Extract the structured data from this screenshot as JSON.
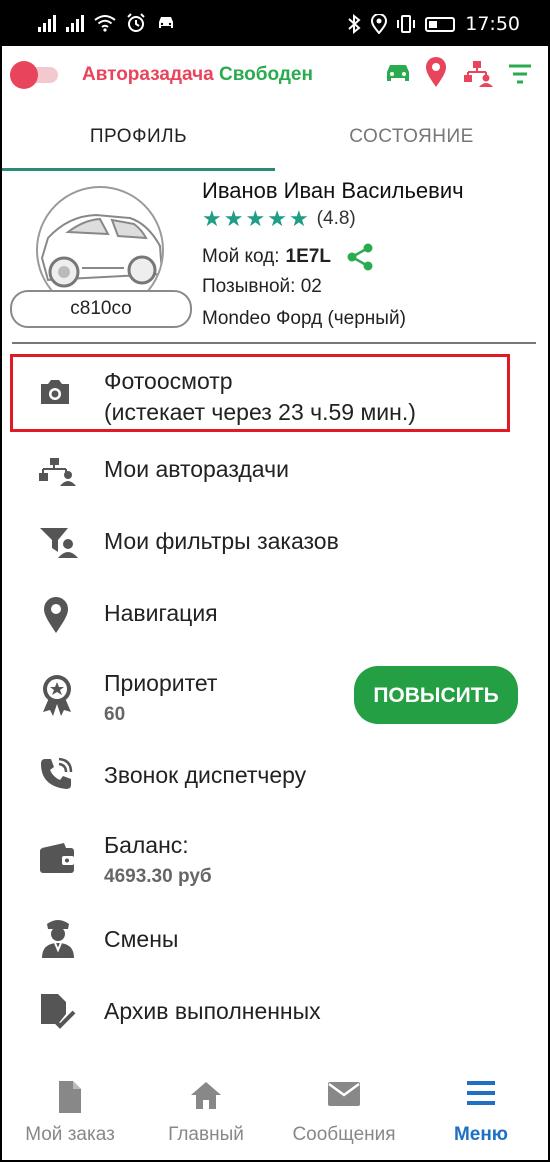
{
  "status_bar": {
    "time": "17:50"
  },
  "app_bar": {
    "title_prefix": "Авторазадача",
    "title_status": "Свободен",
    "colors": {
      "accent_red": "#e8445c",
      "accent_green": "#2bab4f"
    },
    "icons": [
      "car-icon",
      "location-pin-icon",
      "hierarchy-users-icon",
      "filter-icon"
    ]
  },
  "tabs": [
    {
      "label": "ПРОФИЛЬ",
      "active": true
    },
    {
      "label": "СОСТОЯНИЕ",
      "active": false
    }
  ],
  "profile": {
    "name": "Иванов Иван Васильевич",
    "rating_value": 4.8,
    "rating_text": "(4.8)",
    "code_label": "Мой код:",
    "code_value": "1E7L",
    "callsign": "Позывной: 02",
    "car": "Mondeo Форд (черный)",
    "plate": "с810со"
  },
  "menu": {
    "photo_inspection": {
      "label": "Фотоосмотр",
      "sub": "(истекает через 23 ч.59 мин.)"
    },
    "my_auto_dispatch": {
      "label": "Мои автораздачи"
    },
    "my_order_filters": {
      "label": "Мои фильтры заказов"
    },
    "navigation": {
      "label": "Навигация"
    },
    "priority": {
      "label": "Приоритет",
      "value": "60",
      "button": "ПОВЫСИТЬ"
    },
    "call_dispatcher": {
      "label": "Звонок диспетчеру"
    },
    "balance": {
      "label": "Баланс:",
      "value": "4693.30 руб"
    },
    "shifts": {
      "label": "Смены"
    },
    "archive": {
      "label": "Архив выполненных"
    }
  },
  "bottom_nav": [
    {
      "label": "Мой заказ",
      "icon": "document-icon",
      "active": false
    },
    {
      "label": "Главный",
      "icon": "home-icon",
      "active": false
    },
    {
      "label": "Сообщения",
      "icon": "envelope-icon",
      "active": false
    },
    {
      "label": "Меню",
      "icon": "menu-icon",
      "active": true
    }
  ]
}
